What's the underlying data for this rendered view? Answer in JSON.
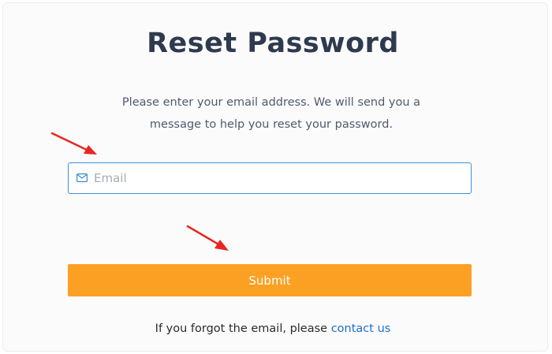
{
  "page": {
    "title": "Reset Password",
    "description": "Please enter your email address. We will send you a message to help you reset your password."
  },
  "form": {
    "email_placeholder": "Email",
    "email_value": "",
    "submit_label": "Submit"
  },
  "footer": {
    "prefix": "If you forgot the email, please",
    "link_label": "contact us"
  },
  "colors": {
    "title": "#2e3a4e",
    "submit_bg": "#fca023",
    "input_border": "#3b8fd6",
    "link": "#1d6fc7",
    "annotation_arrow": "#e8261f"
  },
  "icons": {
    "email": "envelope-icon"
  }
}
